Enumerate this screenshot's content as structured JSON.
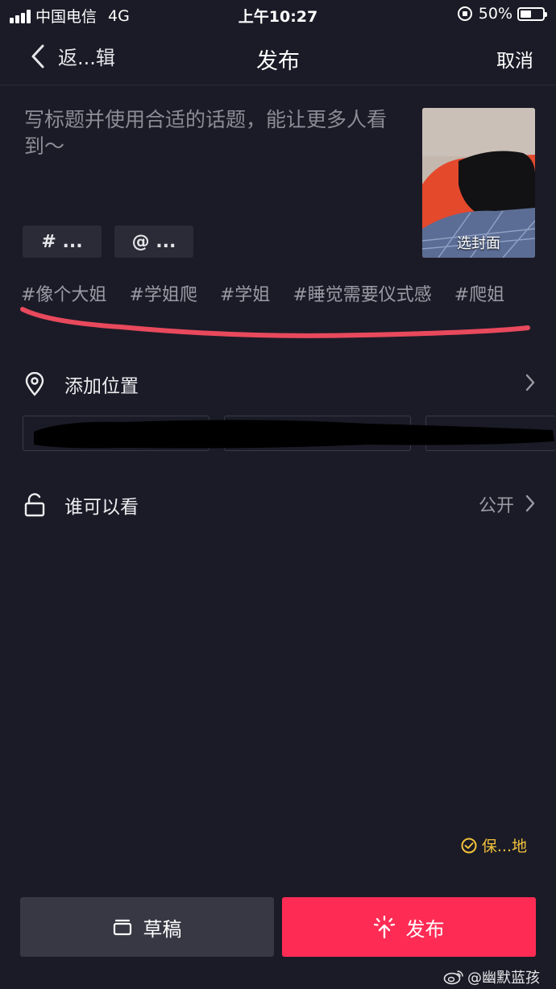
{
  "status_bar": {
    "carrier": "中国电信",
    "network": "4G",
    "time": "上午10:27",
    "battery": "50%",
    "battery_level": 0.5
  },
  "nav": {
    "back_label": "返...辑",
    "title": "发布",
    "cancel_label": "取消"
  },
  "caption": {
    "placeholder": "写标题并使用合适的话题，能让更多人看到～"
  },
  "cover": {
    "label": "选封面"
  },
  "chips": {
    "hashtag": "# ...",
    "mention": "@ ..."
  },
  "hashtag_suggestions": [
    "#像个大姐",
    "#学姐爬",
    "#学姐",
    "#睡觉需要仪式感",
    "#爬姐"
  ],
  "location": {
    "label": "添加位置"
  },
  "visibility": {
    "label": "谁可以看",
    "value": "公开"
  },
  "save_local": "保...地",
  "buttons": {
    "draft": "草稿",
    "publish": "发布"
  },
  "watermark": "@幽默蓝孩",
  "colors": {
    "background": "#1b1b27",
    "publish": "#fe2c55",
    "draft": "#383844",
    "save_local": "#f3c33b",
    "annotation": "#e8495c"
  }
}
